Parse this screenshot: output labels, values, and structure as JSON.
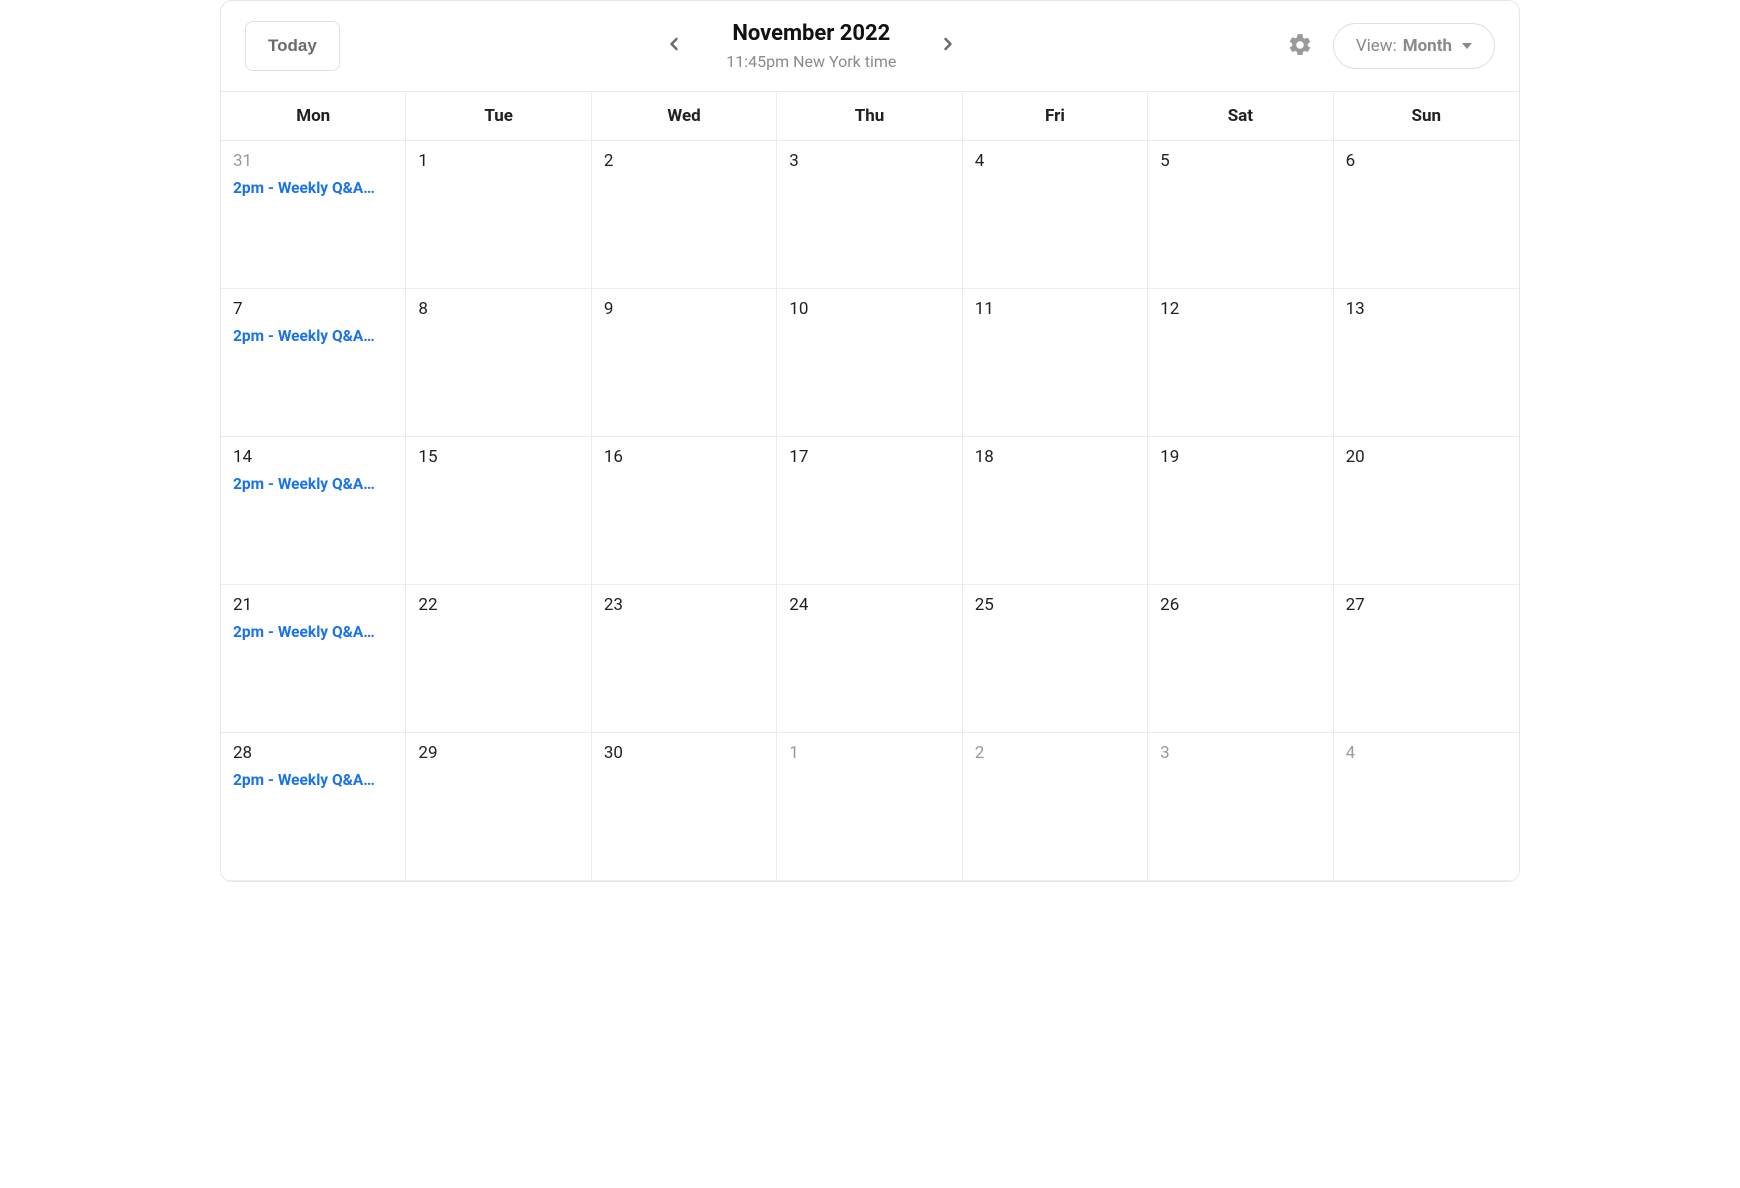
{
  "toolbar": {
    "today_label": "Today",
    "title": "November 2022",
    "subtitle": "11:45pm New York time",
    "view_prefix": "View: ",
    "view_value": "Month"
  },
  "weekdays": [
    "Mon",
    "Tue",
    "Wed",
    "Thu",
    "Fri",
    "Sat",
    "Sun"
  ],
  "event_label": "2pm - Weekly Q&A…",
  "cells": [
    {
      "day": "31",
      "muted": true,
      "has_event": true
    },
    {
      "day": "1",
      "muted": false,
      "has_event": false
    },
    {
      "day": "2",
      "muted": false,
      "has_event": false
    },
    {
      "day": "3",
      "muted": false,
      "has_event": false
    },
    {
      "day": "4",
      "muted": false,
      "has_event": false
    },
    {
      "day": "5",
      "muted": false,
      "has_event": false
    },
    {
      "day": "6",
      "muted": false,
      "has_event": false
    },
    {
      "day": "7",
      "muted": false,
      "has_event": true
    },
    {
      "day": "8",
      "muted": false,
      "has_event": false
    },
    {
      "day": "9",
      "muted": false,
      "has_event": false
    },
    {
      "day": "10",
      "muted": false,
      "has_event": false
    },
    {
      "day": "11",
      "muted": false,
      "has_event": false
    },
    {
      "day": "12",
      "muted": false,
      "has_event": false
    },
    {
      "day": "13",
      "muted": false,
      "has_event": false
    },
    {
      "day": "14",
      "muted": false,
      "has_event": true
    },
    {
      "day": "15",
      "muted": false,
      "has_event": false
    },
    {
      "day": "16",
      "muted": false,
      "has_event": false
    },
    {
      "day": "17",
      "muted": false,
      "has_event": false
    },
    {
      "day": "18",
      "muted": false,
      "has_event": false
    },
    {
      "day": "19",
      "muted": false,
      "has_event": false
    },
    {
      "day": "20",
      "muted": false,
      "has_event": false
    },
    {
      "day": "21",
      "muted": false,
      "has_event": true
    },
    {
      "day": "22",
      "muted": false,
      "has_event": false
    },
    {
      "day": "23",
      "muted": false,
      "has_event": false
    },
    {
      "day": "24",
      "muted": false,
      "has_event": false
    },
    {
      "day": "25",
      "muted": false,
      "has_event": false
    },
    {
      "day": "26",
      "muted": false,
      "has_event": false
    },
    {
      "day": "27",
      "muted": false,
      "has_event": false
    },
    {
      "day": "28",
      "muted": false,
      "has_event": true
    },
    {
      "day": "29",
      "muted": false,
      "has_event": false
    },
    {
      "day": "30",
      "muted": false,
      "has_event": false
    },
    {
      "day": "1",
      "muted": true,
      "has_event": false
    },
    {
      "day": "2",
      "muted": true,
      "has_event": false
    },
    {
      "day": "3",
      "muted": true,
      "has_event": false
    },
    {
      "day": "4",
      "muted": true,
      "has_event": false
    }
  ]
}
